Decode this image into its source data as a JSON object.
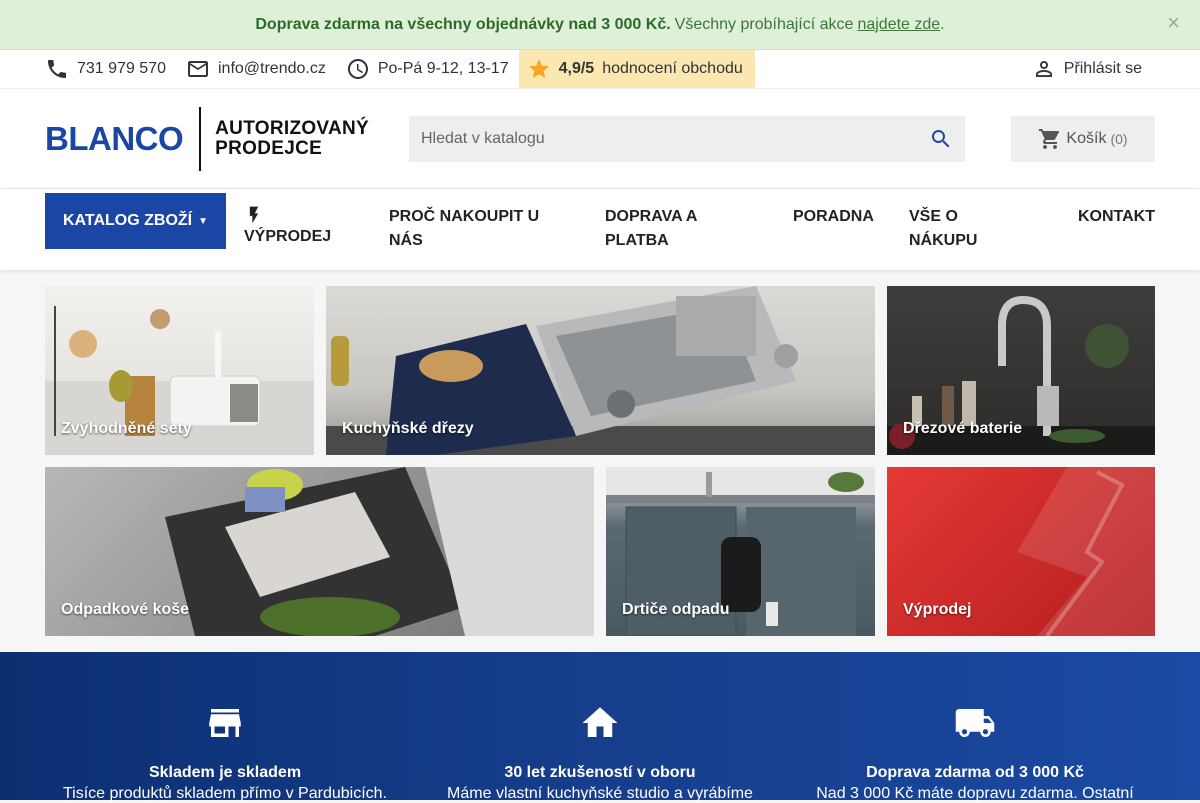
{
  "banner": {
    "bold": "Doprava zdarma na všechny objednávky nad 3 000 Kč.",
    "text": "Všechny probíhající akce",
    "link": "najdete zde",
    "after": ".",
    "close": "×"
  },
  "topbar": {
    "phone": "731 979 570",
    "email": "info@trendo.cz",
    "hours": "Po-Pá 9-12, 13-17",
    "rating_value": "4,9/5",
    "rating_label": "hodnocení obchodu",
    "login": "Přihlásit se"
  },
  "header": {
    "logo_brand": "BLANCO",
    "logo_line1": "AUTORIZOVANÝ",
    "logo_line2": "PRODEJCE",
    "search_placeholder": "Hledat v katalogu",
    "cart_label": "Košík",
    "cart_count": "(0)"
  },
  "nav": {
    "catalog": "KATALOG ZBOŽÍ",
    "items": [
      "VÝPRODEJ",
      "PROČ NAKOUPIT U NÁS",
      "DOPRAVA A PLATBA",
      "PORADNA",
      "VŠE O NÁKUPU",
      "KONTAKT"
    ]
  },
  "categories": [
    {
      "label": "Zvýhodněné sety"
    },
    {
      "label": "Kuchyňské dřezy"
    },
    {
      "label": "Dřezové baterie"
    },
    {
      "label": "Odpadkové koše"
    },
    {
      "label": "Drtiče odpadu"
    },
    {
      "label": "Výprodej"
    }
  ],
  "features": [
    {
      "icon": "store-icon",
      "title": "Skladem je skladem",
      "desc": "Tisíce produktů skladem přímo v Pardubicích."
    },
    {
      "icon": "home-icon",
      "title": "30 let zkušeností v oboru",
      "desc": "Máme vlastní kuchyňské studio a vyrábíme"
    },
    {
      "icon": "truck-icon",
      "title": "Doprava zdarma od 3 000 Kč",
      "desc": "Nad 3 000 Kč máte dopravu zdarma. Ostatní"
    }
  ],
  "colors": {
    "brand": "#1a47a5",
    "banner_bg": "#dff0d8",
    "rating_bg": "#fbe7b2",
    "footer_blue": "#163e8c"
  }
}
